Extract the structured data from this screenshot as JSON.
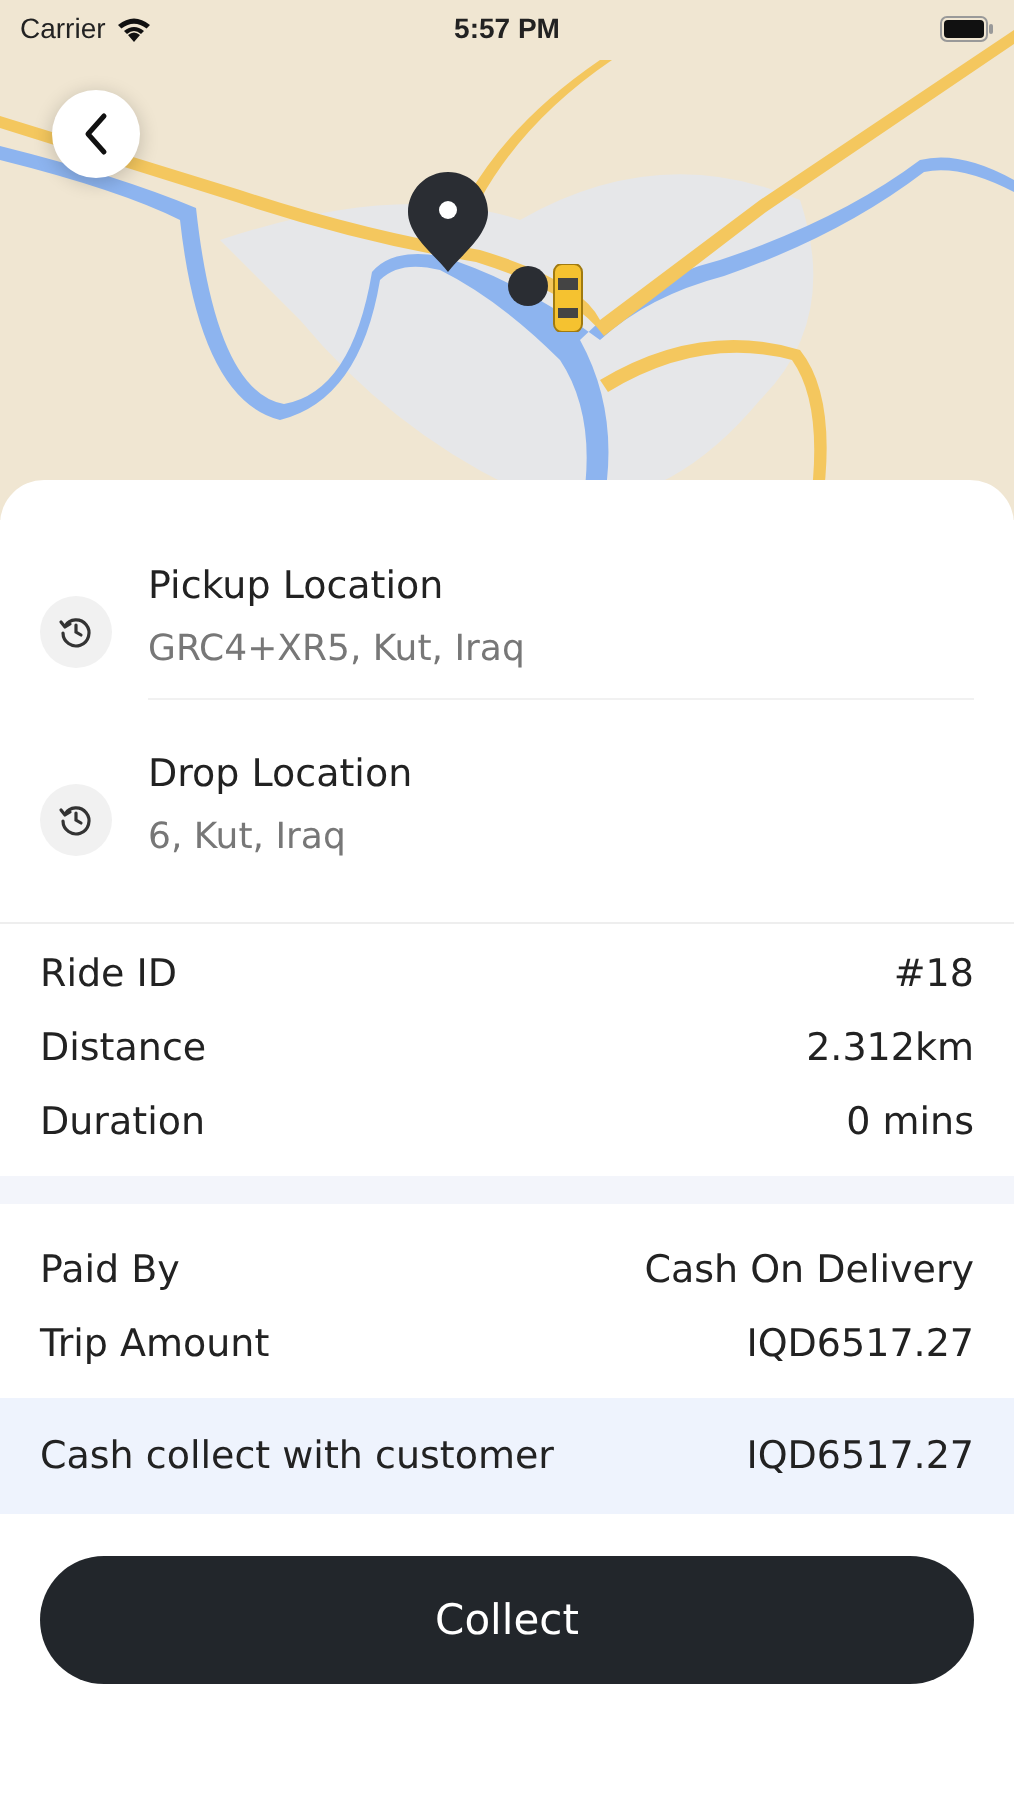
{
  "status_bar": {
    "carrier": "Carrier",
    "time": "5:57 PM"
  },
  "locations": [
    {
      "label": "Pickup Location",
      "address": "GRC4+XR5, Kut, Iraq"
    },
    {
      "label": "Drop Location",
      "address": "6, Kut, Iraq"
    }
  ],
  "ride_details": [
    {
      "label": "Ride ID",
      "value": "#18"
    },
    {
      "label": "Distance",
      "value": "2.312km"
    },
    {
      "label": "Duration",
      "value": "0 mins"
    }
  ],
  "payment": [
    {
      "label": "Paid By",
      "value": "Cash On Delivery"
    },
    {
      "label": "Trip Amount",
      "value": "IQD6517.27"
    }
  ],
  "cash_collect": {
    "label": "Cash collect with customer",
    "value": "IQD6517.27"
  },
  "action_button": "Collect"
}
